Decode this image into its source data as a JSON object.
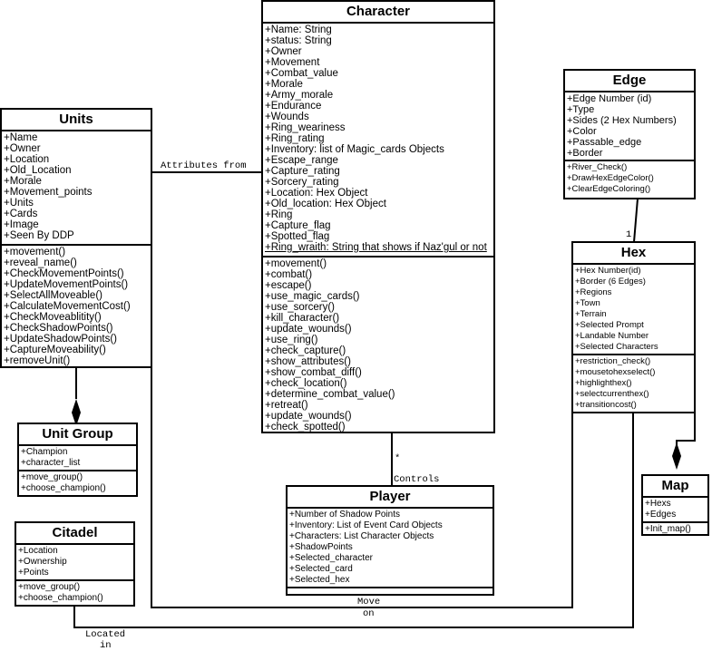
{
  "classes": {
    "character": {
      "name": "Character",
      "attributes": [
        "+Name: String",
        "+status: String",
        "+Owner",
        "+Movement",
        "+Combat_value",
        "+Morale",
        "+Army_morale",
        "+Endurance",
        "+Wounds",
        "+Ring_weariness",
        "+Ring_rating",
        "+Inventory: list of Magic_cards Objects",
        "+Escape_range",
        "+Capture_rating",
        "+Sorcery_rating",
        "+Location: Hex Object",
        "+Old_location: Hex Object",
        "+Ring",
        "+Capture_flag",
        "+Spotted_flag",
        "+Ring_wraith: String that shows if Naz'gul or not"
      ],
      "methods": [
        "+movement()",
        "+combat()",
        "+escape()",
        "+use_magic_cards()",
        "+use_sorcery()",
        "+kill_character()",
        "+update_wounds()",
        "+use_ring()",
        "+check_capture()",
        "+show_attributes()",
        "+show_combat_diff()",
        "+check_location()",
        "+determine_combat_value()",
        "+retreat()",
        "+update_wounds()",
        "+check_spotted()"
      ]
    },
    "units": {
      "name": "Units",
      "attributes": [
        "+Name",
        "+Owner",
        "+Location",
        "+Old_Location",
        "+Morale",
        "+Movement_points",
        "+Units",
        "+Cards",
        "+Image",
        "+Seen By DDP"
      ],
      "methods": [
        "+movement()",
        "+reveal_name()",
        "+CheckMovementPoints()",
        "+UpdateMovementPoints()",
        "+SelectAllMoveable()",
        "+CalculateMovementCost()",
        "+CheckMoveablitity()",
        "+CheckShadowPoints()",
        "+UpdateShadowPoints()",
        "+CaptureMoveability()",
        "+removeUnit()"
      ]
    },
    "unit_group": {
      "name": "Unit Group",
      "attributes": [
        "+Champion",
        "+character_list"
      ],
      "methods": [
        "+move_group()",
        "+choose_champion()"
      ]
    },
    "citadel": {
      "name": "Citadel",
      "attributes": [
        "+Location",
        "+Ownership",
        "+Points"
      ],
      "methods": [
        "+move_group()",
        "+choose_champion()"
      ]
    },
    "player": {
      "name": "Player",
      "attributes": [
        "+Number of Shadow Points",
        "+Inventory: List of Event Card Objects",
        "+Characters: List Character Objects",
        "+ShadowPoints",
        "+Selected_character",
        "+Selected_card",
        "+Selected_hex"
      ],
      "methods": []
    },
    "edge": {
      "name": "Edge",
      "attributes": [
        "+Edge Number (id)",
        "+Type",
        "+Sides (2 Hex Numbers)",
        "+Color",
        "+Passable_edge",
        "+Border"
      ],
      "methods": [
        "+River_Check()",
        "+DrawHexEdgeColor()",
        "+ClearEdgeColoring()"
      ]
    },
    "hex": {
      "name": "Hex",
      "attributes": [
        "+Hex Number(id)",
        "+Border (6 Edges)",
        "+Regions",
        "+Town",
        "+Terrain",
        "+Selected Prompt",
        "+Landable Number",
        "+Selected Characters"
      ],
      "methods": [
        "+restriction_check()",
        "+mousetohexselect()",
        "+highlighthex()",
        "+selectcurrenthex()",
        "+transitioncost()"
      ]
    },
    "map": {
      "name": "Map",
      "attributes": [
        "+Hexs",
        "+Edges"
      ],
      "methods": [
        "+Init_map()"
      ]
    }
  },
  "relations": {
    "attributes_from": "Attributes from",
    "controls_multiplicity": "*",
    "controls": "Controls",
    "edge_hex_multiplicity": "1",
    "move_on_1": "Move",
    "move_on_2": "on",
    "located_in_1": "Located",
    "located_in_2": "in"
  }
}
